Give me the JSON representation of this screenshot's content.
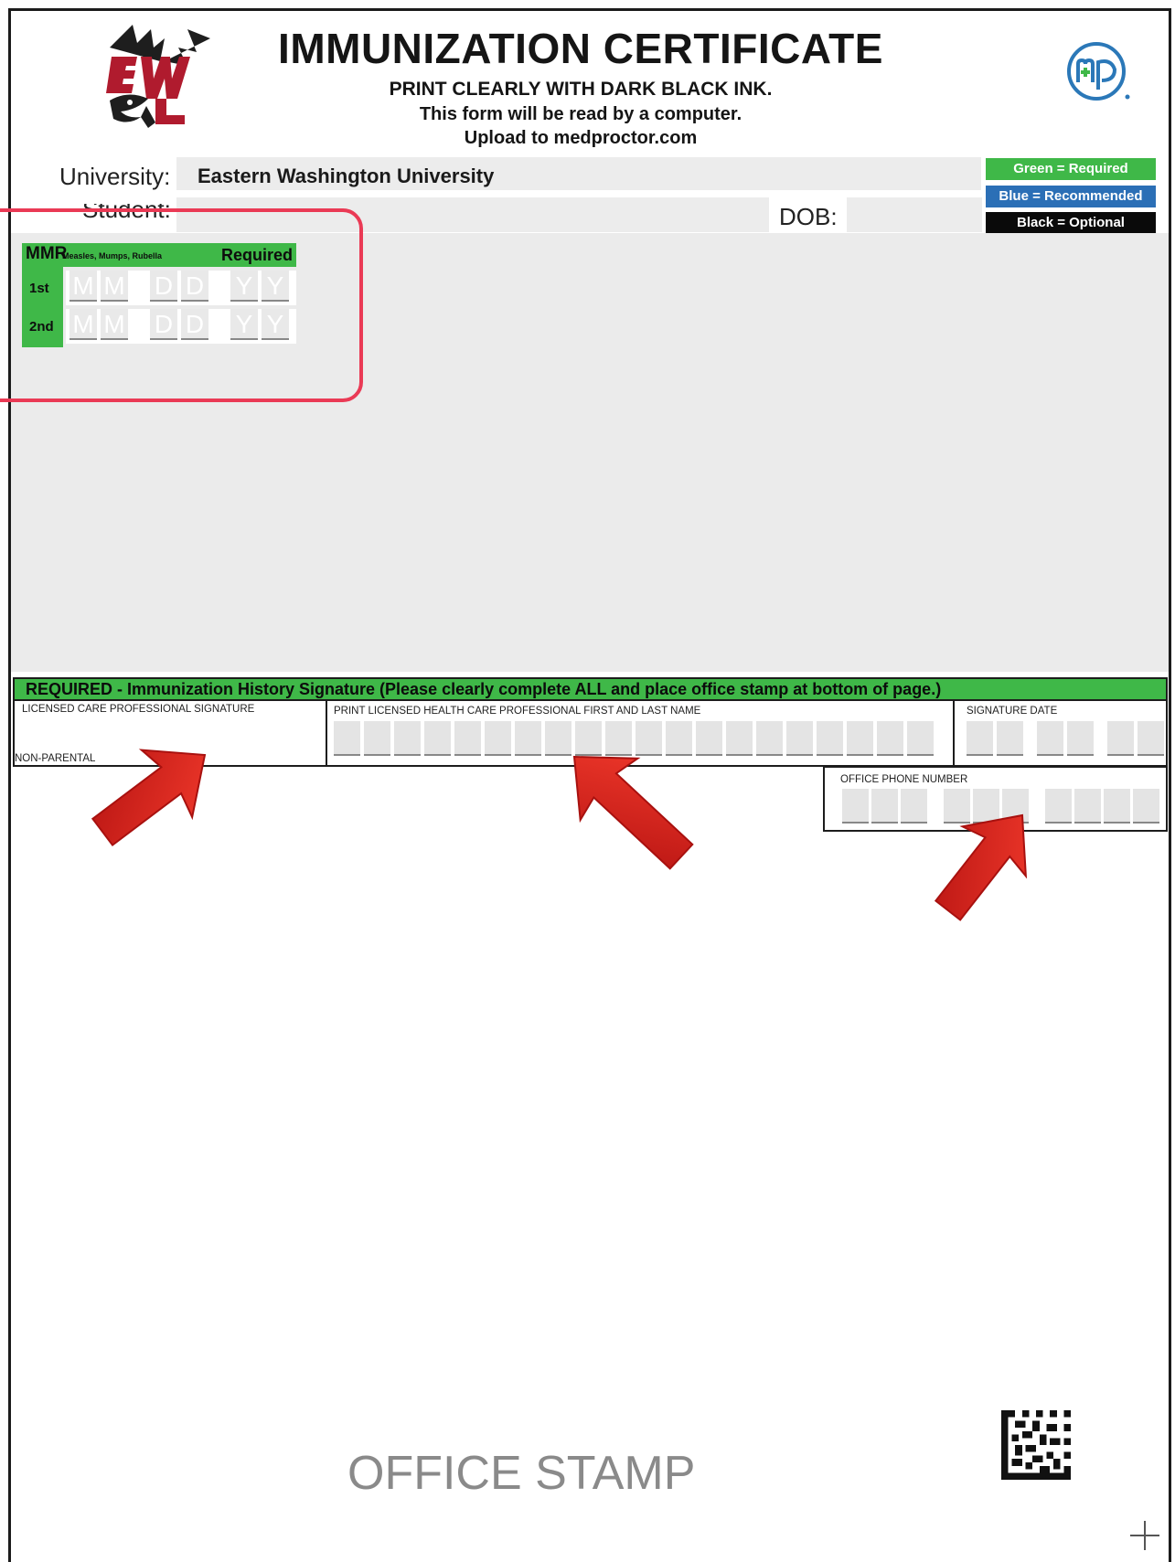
{
  "header": {
    "title": "IMMUNIZATION CERTIFICATE",
    "line1": "PRINT CLEARLY WITH DARK BLACK INK.",
    "line2": "This form will be read by a computer.",
    "line3": "Upload to medproctor.com"
  },
  "fields": {
    "university_label": "University:",
    "university_value": "Eastern Washington University",
    "student_label": "Student:",
    "dob_label": "DOB:"
  },
  "legend": {
    "green": "Green = Required",
    "blue": "Blue = Recommended",
    "black": "Black = Optional"
  },
  "colors": {
    "green": "#3fb848",
    "blue": "#2b6fb6",
    "black": "#0a0a0a",
    "highlight": "#ea3a55",
    "arrow": "#d9201c"
  },
  "mmr": {
    "title": "MMR",
    "subtitle": "Measles, Mumps, Rubella",
    "required": "Required",
    "row1": "1st",
    "row2": "2nd",
    "placeholders": [
      "M",
      "M",
      "D",
      "D",
      "Y",
      "Y"
    ]
  },
  "signature": {
    "bar_text": "REQUIRED - Immunization History Signature (Please clearly complete ALL and place office stamp at bottom of page.)",
    "professional_signature_label": "LICENSED CARE PROFESSIONAL SIGNATURE",
    "non_parental": "NON-PARENTAL",
    "print_name_label": "PRINT LICENSED HEALTH CARE PROFESSIONAL FIRST AND LAST NAME",
    "signature_date_label": "SIGNATURE DATE",
    "office_phone_label": "OFFICE PHONE NUMBER"
  },
  "footer": {
    "office_stamp": "OFFICE STAMP"
  },
  "icons": {
    "left_logo": "eagle-logo-icon",
    "right_logo": "medproctor-logo-icon",
    "barcode": "qr-code-icon",
    "plus": "plus-icon",
    "arrows": "arrow-icon"
  }
}
